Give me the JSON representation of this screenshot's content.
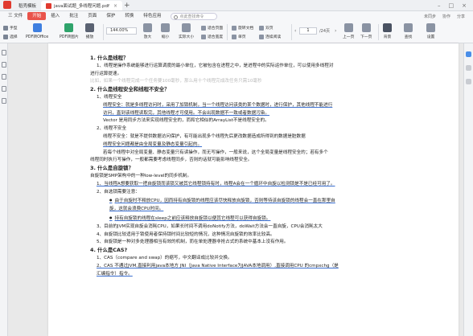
{
  "titlebar": {
    "tabs": [
      {
        "label": "稻壳模板",
        "active": false
      },
      {
        "label": "java面试题_多线程问题.pdf",
        "active": true
      }
    ],
    "add_tab": "+"
  },
  "menubar": {
    "items": [
      "三 文件",
      "开始",
      "插入",
      "批注",
      "页面",
      "保护",
      "转换",
      "特色应用"
    ],
    "active": "开始",
    "search_placeholder": "点此查找命令",
    "right": [
      "未同步",
      "协作",
      "分享"
    ]
  },
  "ribbon": {
    "tools": [
      {
        "label": "手型",
        "icon": "hand-icon"
      },
      {
        "label": "选择",
        "icon": "cursor-icon"
      },
      {
        "label": "PDF转Office",
        "icon": "convert-icon"
      },
      {
        "label": "PDF转图片",
        "icon": "image-icon"
      },
      {
        "label": "播放",
        "icon": "play-icon"
      },
      {
        "label": "阅读模式",
        "icon": "book-icon"
      }
    ],
    "zoom": "144.00%",
    "zoom_tools": [
      {
        "label": "放大",
        "icon": "zoom-in-icon"
      },
      {
        "label": "缩小",
        "icon": "zoom-out-icon"
      },
      {
        "label": "实际大小",
        "icon": "actual-size-icon"
      },
      {
        "label": "适合页面",
        "icon": "fit-page-icon"
      },
      {
        "label": "适合宽度",
        "icon": "fit-width-icon"
      }
    ],
    "more_tools": [
      {
        "label": "旋转文档",
        "icon": "rotate-icon"
      },
      {
        "label": "单页",
        "icon": "single-page-icon"
      },
      {
        "label": "双页",
        "icon": "double-page-icon"
      },
      {
        "label": "连续阅读",
        "icon": "continuous-icon"
      },
      {
        "label": "自动滚动",
        "icon": "autoscroll-icon"
      },
      {
        "label": "截图和对比",
        "icon": "screenshot-icon"
      }
    ],
    "page_current": "1",
    "page_total": "/24页",
    "nav": [
      {
        "label": "上一页",
        "icon": "prev-page-icon"
      },
      {
        "label": "下一页",
        "icon": "next-page-icon"
      }
    ],
    "right_tools": [
      {
        "label": "背景",
        "icon": "background-icon"
      },
      {
        "label": "查找",
        "icon": "find-icon"
      },
      {
        "label": "设置",
        "icon": "settings-icon"
      }
    ]
  },
  "document": {
    "lines": [
      {
        "text": "1. 什么是线程？",
        "style": "h"
      },
      {
        "text": "1、线程是操作系统能够进行运算调度的最小单位，它被包含在进程之中，是进程中的实际运作单位，可以使用多线程对",
        "style": "i1"
      },
      {
        "text": "进行运算提速。",
        "style": "p"
      },
      {
        "text": "比如，如果一个线程完成一个任务要100毫秒，那么用十个线程完成改任务只需10毫秒",
        "style": "faint"
      },
      {
        "text": "2. 什么是线程安全和线程不安全？",
        "style": "h"
      },
      {
        "text": "1、线程安全",
        "style": "i1"
      },
      {
        "text": "线程安全：就是多线程访问时，采用了加锁机制，当一个线程访问该类的某个数据时，进行保护，其他线程不能进行",
        "style": "i2 u"
      },
      {
        "text": "访问，直到该线程读取完，其他线程才可使用。不会出现数据不一致或者数据污染。",
        "style": "i2 u"
      },
      {
        "text": "Vector 是用同步方法来实现线程安全的，而和它相似的ArrayList不是线程安全的。",
        "style": "i2"
      },
      {
        "text": "2、线程不安全",
        "style": "i1"
      },
      {
        "text": "线程不安全：就是不提供数据访问保护，有可能出现多个线程先后更改数据造成所得到的数据是脏数据",
        "style": "i2"
      },
      {
        "text": "线程安全问题都是由全局变量及静态变量引起的。",
        "style": "i2 u"
      },
      {
        "text": "若每个线程中对全局变量、静态变量只有读操作，而无写操作，一般来说，这个全局变量是线程安全的；若有多个",
        "style": "i2"
      },
      {
        "text": "线程同时执行写操作，一般都需要考虑线程同步，否则的话就可能影响线程安全。",
        "style": "p"
      },
      {
        "text": "3. 什么是自旋锁？",
        "style": "h"
      },
      {
        "text": "自旋锁是SMP架构中的一种low-level的同步机制。",
        "style": "p"
      },
      {
        "text": "1、当线程A想要获取一把自旋锁而该锁又被其它线程锁持有时，线程A会在一个循环中自旋以检测锁是不是已经可用了。",
        "style": "i1 u"
      },
      {
        "text": "2、自选锁需要注意：",
        "style": "i1"
      },
      {
        "text": "由于自旋时不释放CPU，因而持有自旋锁的线程应该尽快释放自旋锁，否则等待该自旋锁的线程会一直在那里自",
        "style": "i3 u bullet"
      },
      {
        "text": "旋，这就会浪费CPU时间。",
        "style": "i3 u"
      },
      {
        "text": "持有自旋锁的线程在sleep之前应该释放自旋锁以便其它线程可以获得自旋锁。",
        "style": "i3 u bullet"
      },
      {
        "text": "3、目前的JVM实现自旋会消耗CPU，如果长时间不调用doNotify方法，doWait方法会一直自旋，CPU会消耗太大",
        "style": "i1"
      },
      {
        "text": "4、自旋锁比较适用于锁使用者保持锁时间比较短的情况，这种情况自旋锁的效率比较高。",
        "style": "i1"
      },
      {
        "text": "5、自旋锁是一种对多处理器相当有效的机制，而在单处理器非抢占式的系统中基本上没有作用。",
        "style": "i1"
      },
      {
        "text": "4. 什么是CAS?",
        "style": "h"
      },
      {
        "text": "1、CAS（compare and swap）的缩写，中文翻译成比较并交换。",
        "style": "i1"
      },
      {
        "text": "2、CAS 不通过JVM,直接利用java本地方 JNI（Java Native Interface为JAVA本地调用）,直接调用CPU 的cmpxchg（是",
        "style": "i1 u"
      },
      {
        "text": "汇编指令）指令。",
        "style": "i1 u"
      }
    ]
  }
}
